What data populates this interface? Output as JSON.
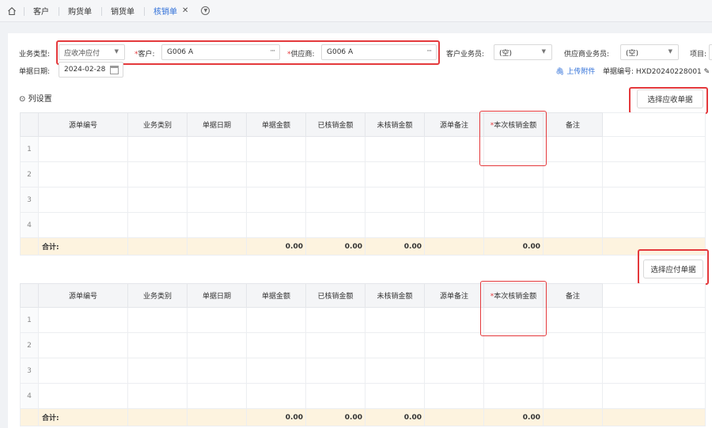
{
  "tabs": [
    {
      "label": "客户"
    },
    {
      "label": "购货单"
    },
    {
      "label": "销货单"
    },
    {
      "label": "核销单"
    }
  ],
  "form": {
    "biz_type_label": "业务类型:",
    "biz_type_value": "应收冲应付",
    "customer_label": "客户:",
    "customer_value": "G006 A",
    "supplier_label": "供应商:",
    "supplier_value": "G006 A",
    "cust_staff_label": "客户业务员:",
    "cust_staff_value": "(空)",
    "supp_staff_label": "供应商业务员:",
    "supp_staff_value": "(空)",
    "project_label": "项目:",
    "date_label": "单据日期:",
    "date_value": "2024-02-28",
    "upload_label": "上传附件",
    "doc_no_label": "单据编号:",
    "doc_no_value": "HXD20240228001"
  },
  "column_settings": "列设置",
  "select_receivable": "选择应收单据",
  "select_payable": "选择应付单据",
  "columns": [
    "源单编号",
    "业务类别",
    "单据日期",
    "单据金额",
    "已核销金额",
    "未核销金额",
    "源单备注",
    "本次核销金额",
    "备注"
  ],
  "required_mark": "*",
  "rows": [
    "1",
    "2",
    "3",
    "4"
  ],
  "totals": {
    "label": "合计:",
    "doc_amount": "0.00",
    "written_off": "0.00",
    "not_written_off": "0.00",
    "this_write_off": "0.00"
  },
  "colors": {
    "accent": "#2f6fd8",
    "highlight": "#e4393c",
    "total_bg": "#fdf3df"
  }
}
